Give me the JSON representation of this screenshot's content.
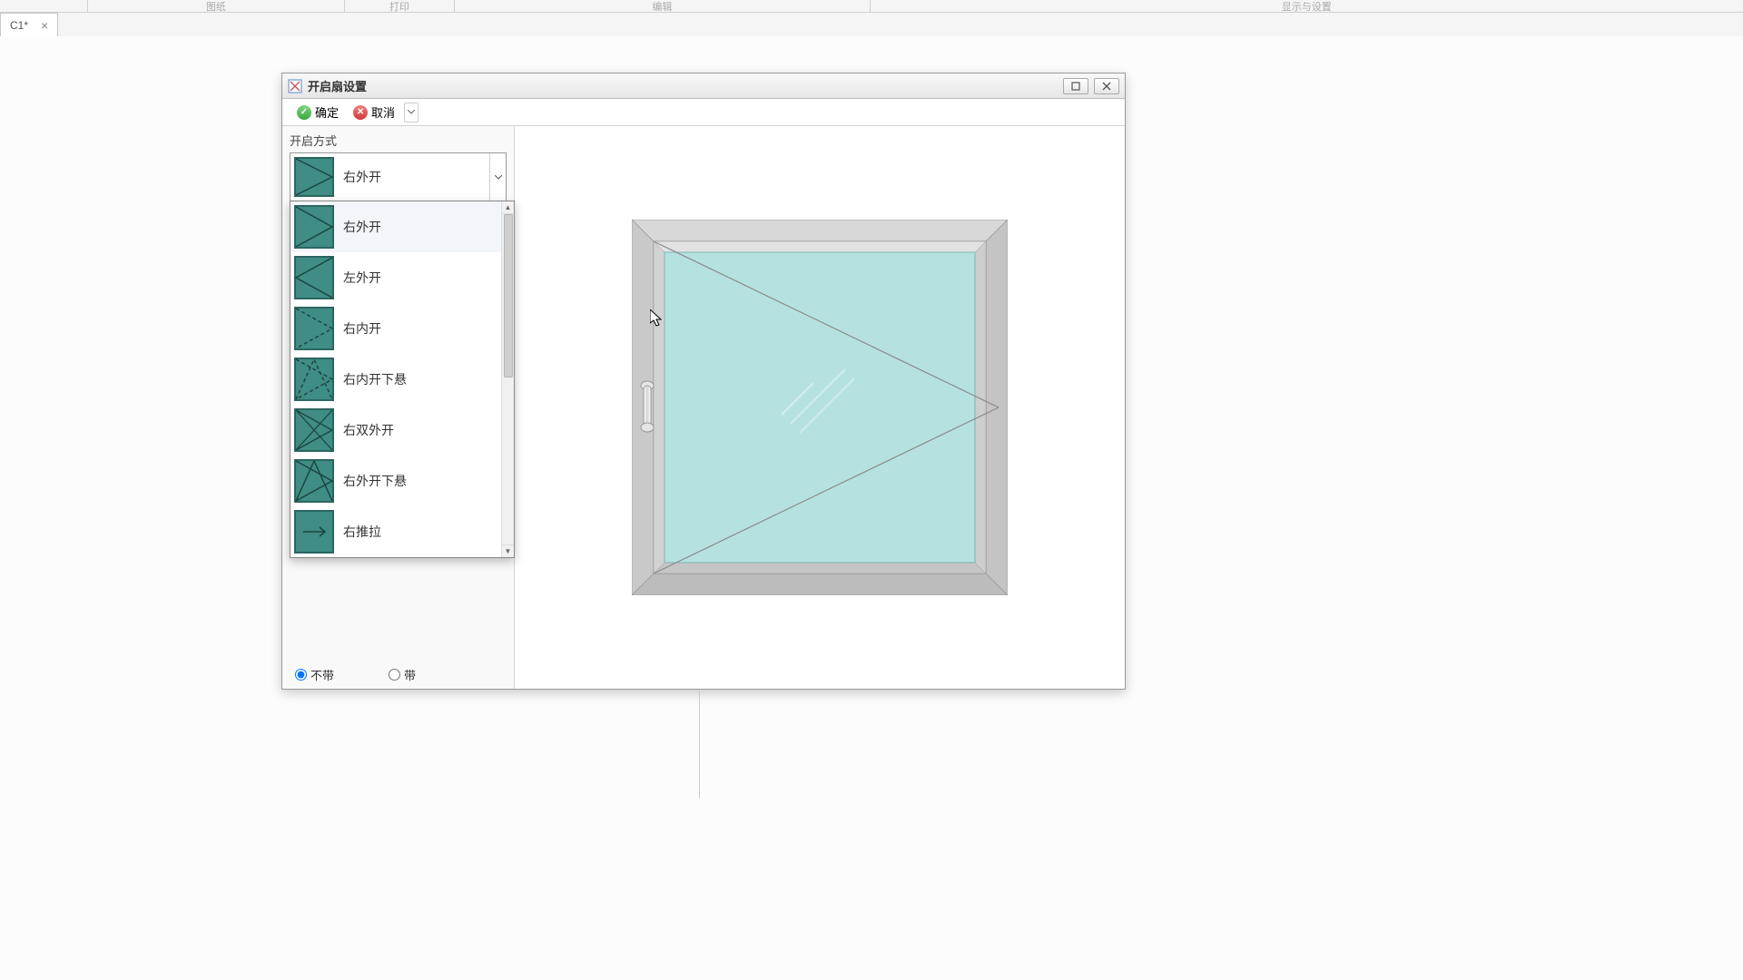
{
  "toolbar": {
    "s2": "图纸",
    "s3": "打印",
    "s4": "编辑",
    "s5": "显示与设置"
  },
  "doc_tab": {
    "label": "C1*"
  },
  "dialog": {
    "title": "开启扇设置",
    "ok_label": "确定",
    "cancel_label": "取消",
    "section_label": "开启方式",
    "selected": "右外开",
    "options": [
      {
        "id": "right-out",
        "label": "右外开"
      },
      {
        "id": "left-out",
        "label": "左外开"
      },
      {
        "id": "right-in",
        "label": "右内开"
      },
      {
        "id": "right-in-down",
        "label": "右内开下悬"
      },
      {
        "id": "right-double-out",
        "label": "右双外开"
      },
      {
        "id": "right-out-down",
        "label": "右外开下悬"
      },
      {
        "id": "right-slide",
        "label": "右推拉"
      }
    ],
    "radio": {
      "without": "不带",
      "with": "带"
    }
  },
  "colors": {
    "glazing": "#b5e2e0",
    "frame_light": "#d8d8d8",
    "frame_dark": "#bcbcbc",
    "teal": "#3f8d85"
  }
}
